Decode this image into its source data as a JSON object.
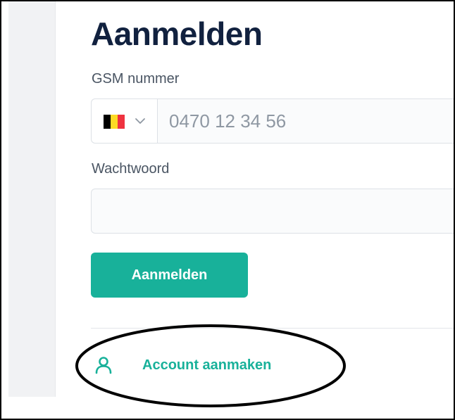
{
  "login": {
    "title": "Aanmelden",
    "phone_label": "GSM nummer",
    "phone_placeholder": "0470 12 34 56",
    "country_flag": "belgium-flag",
    "flag_colors": [
      "#000000",
      "#fdda24",
      "#ef3340"
    ],
    "password_label": "Wachtwoord",
    "password_value": "",
    "submit_label": "Aanmelden",
    "create_account_label": "Account aanmaken",
    "create_account_icon": "user-icon"
  },
  "colors": {
    "accent": "#18b19a",
    "title": "#11213f",
    "label": "#4a5563",
    "placeholder": "#8f98a3",
    "annotation": "#000000"
  }
}
